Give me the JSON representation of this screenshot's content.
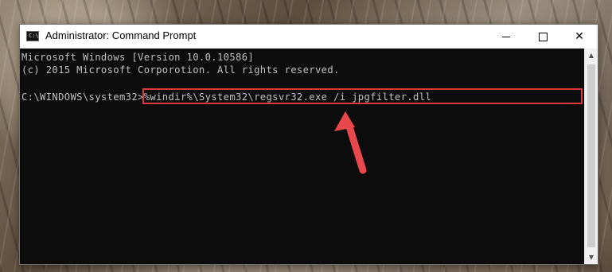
{
  "window": {
    "title": "Administrator: Command Prompt",
    "icon_name": "cmd-icon",
    "icon_glyph": "C:\\",
    "controls": {
      "minimize_icon": "minimize-icon",
      "maximize_icon": "maximize-icon",
      "close_icon": "close-icon",
      "close_glyph": "✕"
    }
  },
  "console": {
    "lines": [
      "Microsoft Windows [Version 10.0.10586]",
      "(c) 2015 Microsoft Corporotion. All rights reserved."
    ],
    "prompt": "C:\\WINDOWS\\system32>",
    "command": "%windir%\\System32\\regsvr32.exe /i jpgfilter.dll",
    "background_color": "#0c0c0c",
    "text_color": "#c0c0c0"
  },
  "annotation": {
    "highlight_color": "#d93b3b",
    "arrow_color": "#e8474b"
  },
  "scrollbar": {
    "up_glyph": "▲",
    "down_glyph": "▼"
  }
}
